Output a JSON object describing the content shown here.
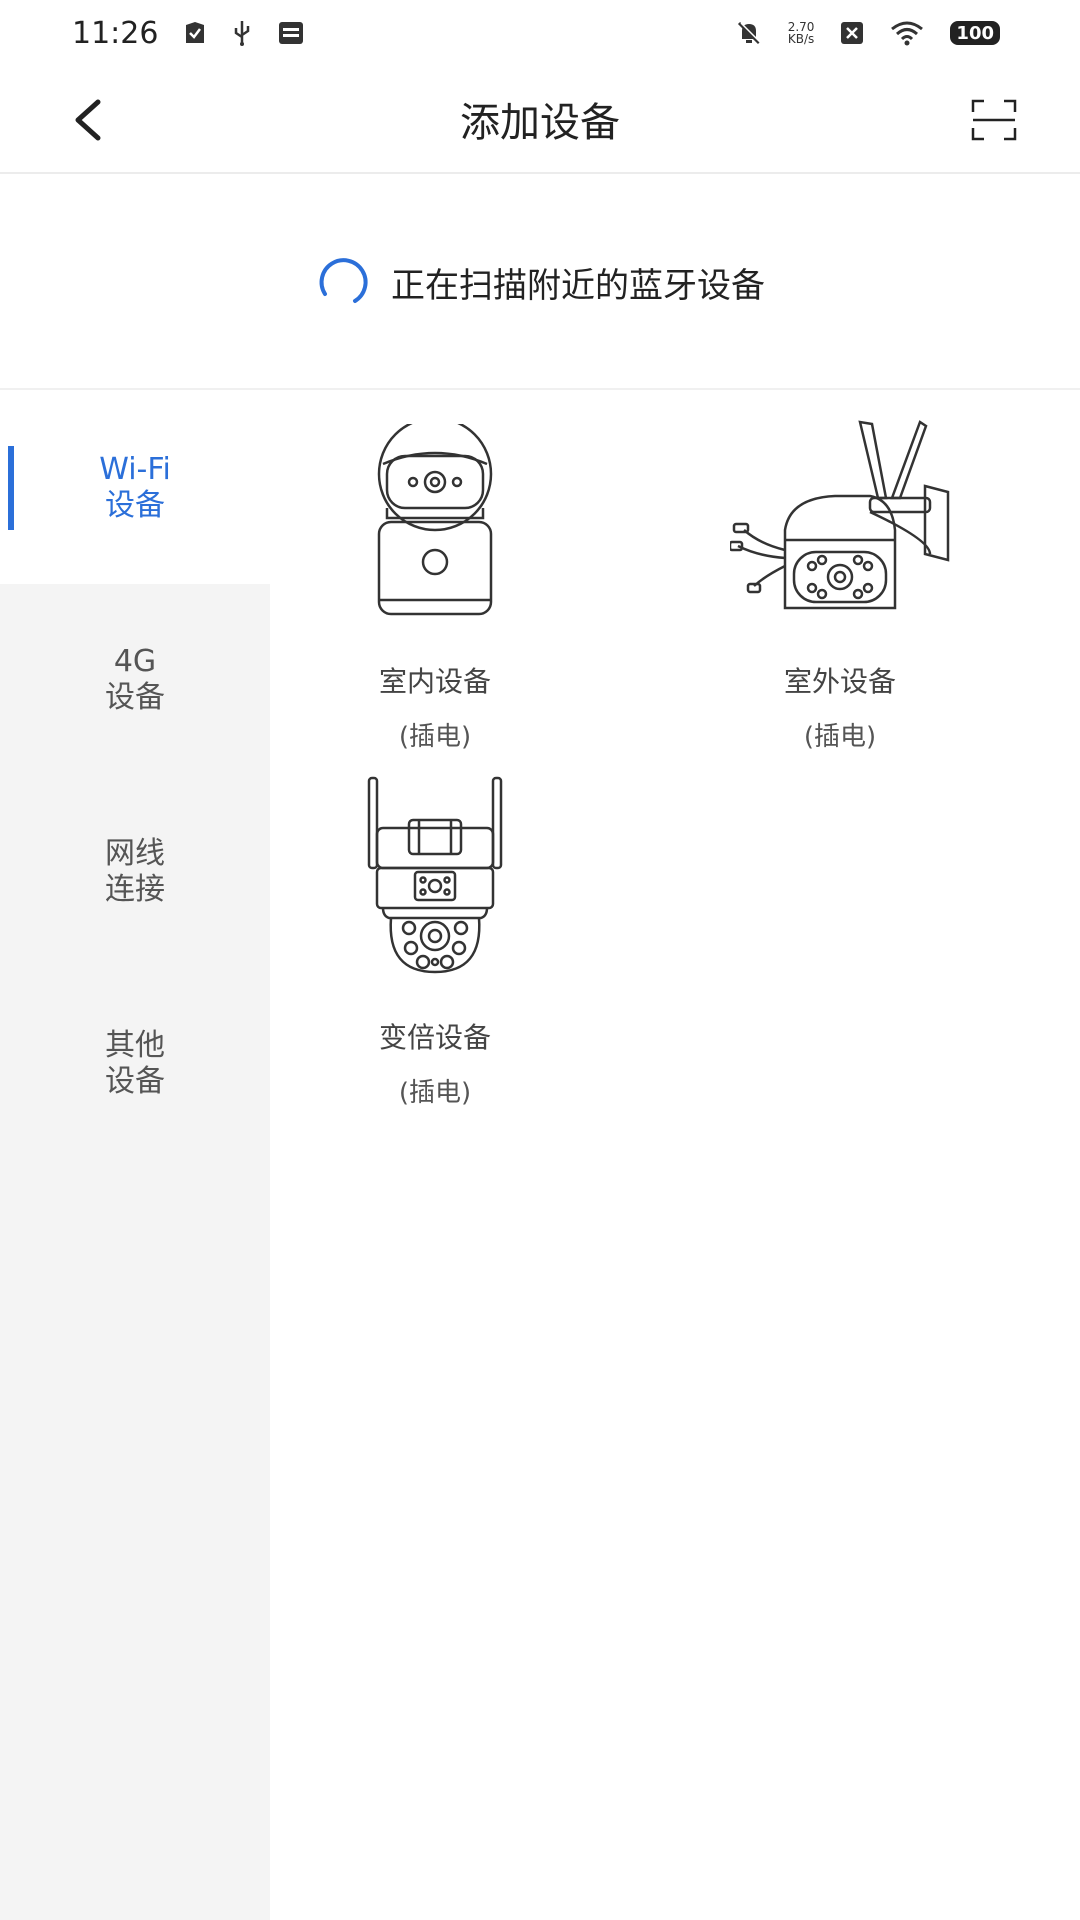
{
  "status_bar": {
    "time": "11:26",
    "net_speed_value": "2.70",
    "net_speed_unit": "KB/s",
    "battery": "100"
  },
  "header": {
    "title": "添加设备"
  },
  "scan": {
    "text": "正在扫描附近的蓝牙设备"
  },
  "sidebar": {
    "items": [
      {
        "label": "Wi-Fi\n设备",
        "active": true
      },
      {
        "label": "4G\n设备",
        "active": false
      },
      {
        "label": "网线\n连接",
        "active": false
      },
      {
        "label": "其他\n设备",
        "active": false
      }
    ]
  },
  "devices": [
    {
      "name": "室内设备",
      "sub": "(插电)",
      "icon": "indoor-camera-icon"
    },
    {
      "name": "室外设备",
      "sub": "(插电)",
      "icon": "outdoor-camera-icon"
    },
    {
      "name": "变倍设备",
      "sub": "(插电)",
      "icon": "zoom-camera-icon"
    }
  ],
  "colors": {
    "accent": "#2b6fd9",
    "sidebar_bg": "#f4f4f4"
  }
}
